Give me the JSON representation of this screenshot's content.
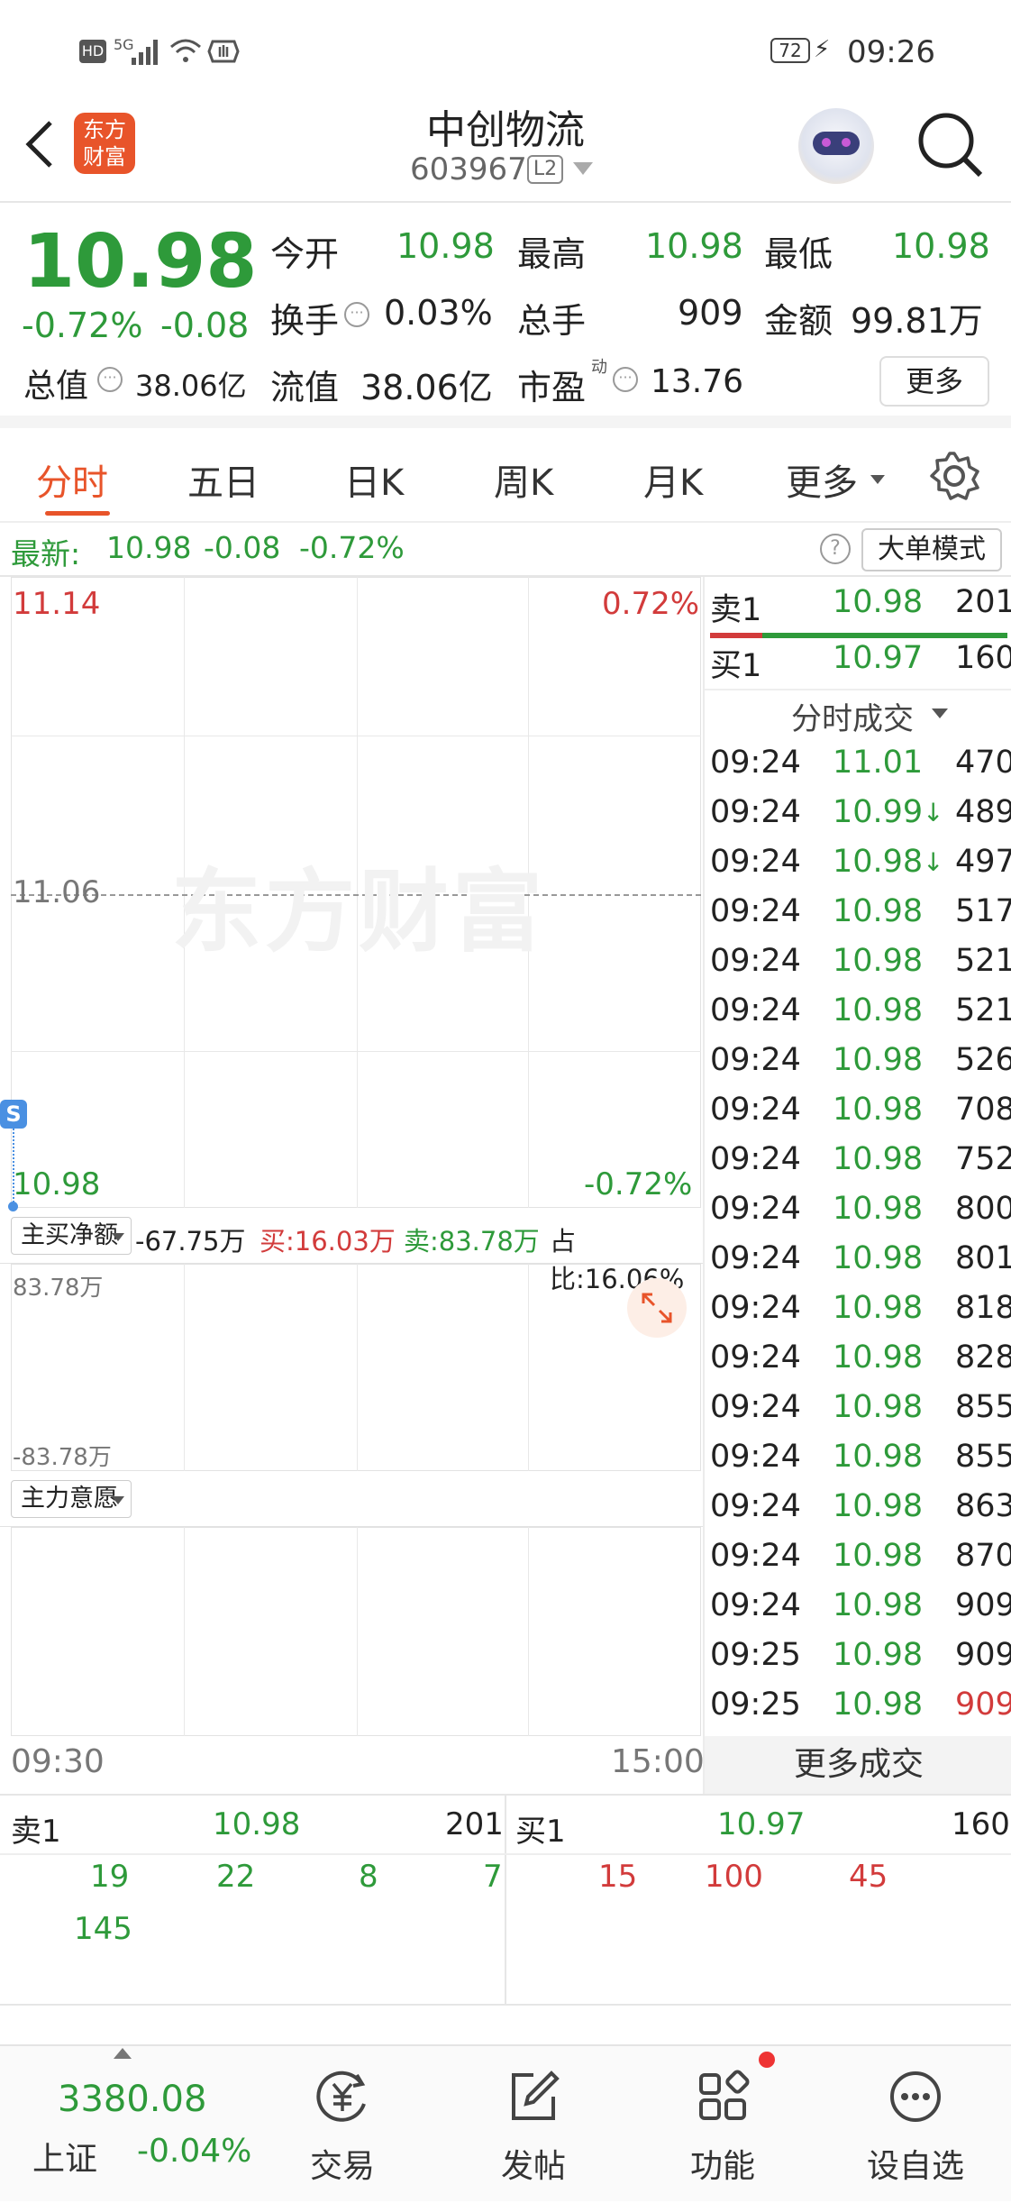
{
  "status_bar": {
    "battery": "72",
    "time": "09:26",
    "net_hd": "HD",
    "net_5g": "5G"
  },
  "header": {
    "back_icon": "chevron-left-icon",
    "logo_text_1": "东方",
    "logo_text_2": "财富",
    "stock_name": "中创物流",
    "stock_code": "603967",
    "level_badge": "L2"
  },
  "quote": {
    "price": "10.98",
    "change_pct": "-0.72%",
    "change_amt": "-0.08",
    "stats": [
      {
        "label": "今开",
        "value": "10.98"
      },
      {
        "label": "最高",
        "value": "10.98"
      },
      {
        "label": "最低",
        "value": "10.98"
      },
      {
        "label": "换手",
        "value": "0.03%"
      },
      {
        "label": "总手",
        "value": "909"
      },
      {
        "label": "金额",
        "value": "99.81万"
      },
      {
        "label": "总值",
        "value": "38.06亿"
      },
      {
        "label": "流值",
        "value": "38.06亿"
      },
      {
        "label": "市盈",
        "value": "13.76"
      }
    ],
    "pe_superscript": "动",
    "more_button": "更多"
  },
  "tabs": {
    "items": [
      "分时",
      "五日",
      "日K",
      "周K",
      "月K",
      "更多"
    ],
    "active": "分时"
  },
  "latest_bar": {
    "label": "最新:",
    "price": "10.98",
    "change": "-0.08",
    "pct": "-0.72%",
    "mode_button": "大单模式"
  },
  "chart": {
    "watermark": "东方财富",
    "y_max": "11.14",
    "y_mid": "11.06",
    "y_min": "10.98",
    "pct_max": "0.72%",
    "pct_min": "-0.72%",
    "s_marker": "S",
    "sub1_selector": "主买净额",
    "sub1_net": "-67.75万",
    "sub1_buy": "买:16.03万",
    "sub1_sell": "卖:83.78万",
    "sub1_ratio": "占比:16.06%",
    "sub1_top": "83.78万",
    "sub1_bottom": "-83.78万",
    "sub2_selector": "主力意愿",
    "time_start": "09:30",
    "time_end": "15:00"
  },
  "panel": {
    "sell1": {
      "label": "卖1",
      "price": "10.98",
      "vol": "201"
    },
    "buy1": {
      "label": "买1",
      "price": "10.97",
      "vol": "160"
    },
    "ticks_title": "分时成交",
    "ticks": [
      {
        "time": "09:24",
        "price": "11.01",
        "arrow": "",
        "vol": "470"
      },
      {
        "time": "09:24",
        "price": "10.99",
        "arrow": "↓",
        "vol": "489"
      },
      {
        "time": "09:24",
        "price": "10.98",
        "arrow": "↓",
        "vol": "497"
      },
      {
        "time": "09:24",
        "price": "10.98",
        "arrow": "",
        "vol": "517"
      },
      {
        "time": "09:24",
        "price": "10.98",
        "arrow": "",
        "vol": "521"
      },
      {
        "time": "09:24",
        "price": "10.98",
        "arrow": "",
        "vol": "521"
      },
      {
        "time": "09:24",
        "price": "10.98",
        "arrow": "",
        "vol": "526"
      },
      {
        "time": "09:24",
        "price": "10.98",
        "arrow": "",
        "vol": "708"
      },
      {
        "time": "09:24",
        "price": "10.98",
        "arrow": "",
        "vol": "752"
      },
      {
        "time": "09:24",
        "price": "10.98",
        "arrow": "",
        "vol": "800"
      },
      {
        "time": "09:24",
        "price": "10.98",
        "arrow": "",
        "vol": "801"
      },
      {
        "time": "09:24",
        "price": "10.98",
        "arrow": "",
        "vol": "818"
      },
      {
        "time": "09:24",
        "price": "10.98",
        "arrow": "",
        "vol": "828"
      },
      {
        "time": "09:24",
        "price": "10.98",
        "arrow": "",
        "vol": "855"
      },
      {
        "time": "09:24",
        "price": "10.98",
        "arrow": "",
        "vol": "855"
      },
      {
        "time": "09:24",
        "price": "10.98",
        "arrow": "",
        "vol": "863"
      },
      {
        "time": "09:24",
        "price": "10.98",
        "arrow": "",
        "vol": "870"
      },
      {
        "time": "09:24",
        "price": "10.98",
        "arrow": "",
        "vol": "909"
      },
      {
        "time": "09:25",
        "price": "10.98",
        "arrow": "",
        "vol": "909"
      },
      {
        "time": "09:25",
        "price": "10.98",
        "arrow": "",
        "vol": "909"
      }
    ],
    "more_ticks": "更多成交"
  },
  "orderbook": {
    "sell": {
      "label": "卖1",
      "price": "10.98",
      "vol": "201",
      "queue": [
        "19",
        "22",
        "8",
        "7",
        "145"
      ]
    },
    "buy": {
      "label": "买1",
      "price": "10.97",
      "vol": "160",
      "queue": [
        "15",
        "100",
        "45"
      ]
    }
  },
  "bottom_nav": {
    "index_price": "3380.08",
    "index_name": "上证",
    "index_change": "-0.04%",
    "items": [
      {
        "label": "交易",
        "icon": "trade-yen-icon"
      },
      {
        "label": "发帖",
        "icon": "edit-post-icon"
      },
      {
        "label": "功能",
        "icon": "grid-function-icon"
      },
      {
        "label": "设自选",
        "icon": "more-dots-icon"
      }
    ]
  },
  "colors": {
    "up": "#d23b3b",
    "down": "#2e9a3a",
    "brand": "#e8542a"
  }
}
